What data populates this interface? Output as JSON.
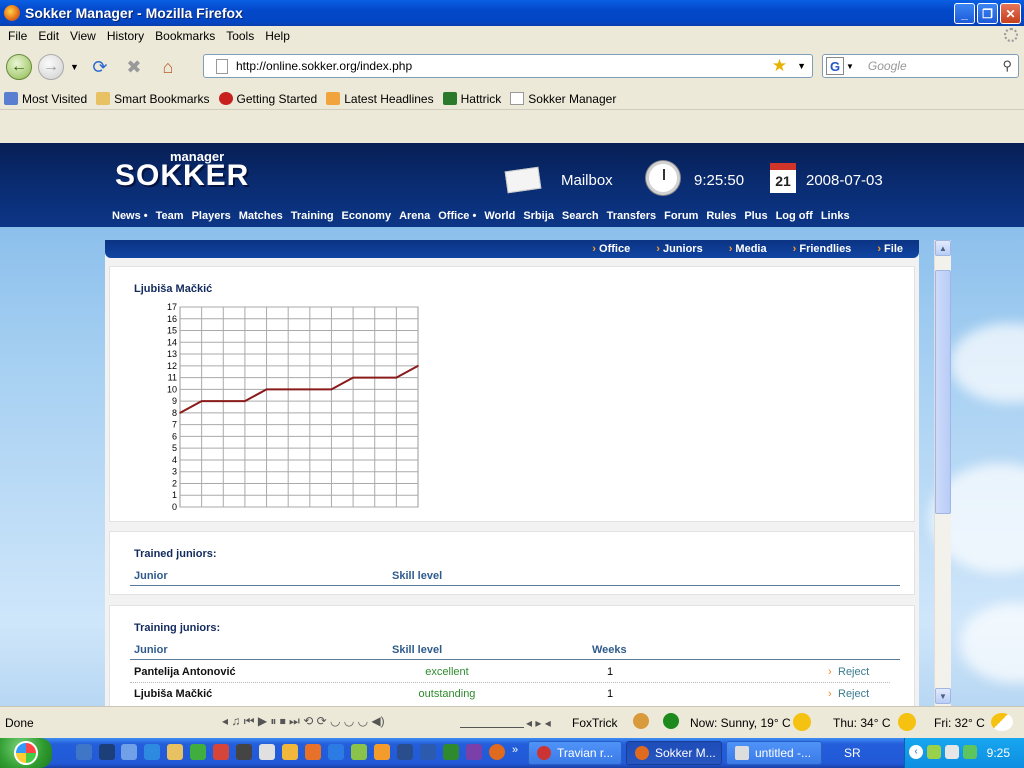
{
  "window": {
    "title": "Sokker Manager - Mozilla Firefox"
  },
  "menu": [
    "File",
    "Edit",
    "View",
    "History",
    "Bookmarks",
    "Tools",
    "Help"
  ],
  "address": {
    "url": "http://online.sokker.org/index.php",
    "search_placeholder": "Google"
  },
  "bookmarks": [
    "Most Visited",
    "Smart Bookmarks",
    "Getting Started",
    "Latest Headlines",
    "Hattrick",
    "Sokker Manager"
  ],
  "site": {
    "logo_small": "manager",
    "logo_big": "SOKKER",
    "mailbox": "Mailbox",
    "time": "9:25:50",
    "date": "2008-07-03",
    "calendar_day": "21",
    "nav": [
      "News •",
      "Team",
      "Players",
      "Matches",
      "Training",
      "Economy",
      "Arena",
      "Office •",
      "World",
      "Srbija",
      "Search",
      "Transfers",
      "Forum",
      "Rules",
      "Plus",
      "Log off",
      "Links"
    ],
    "subnav": [
      "Office",
      "Juniors",
      "Media",
      "Friendlies",
      "File"
    ]
  },
  "chart_panel": {
    "player_name": "Ljubiša Mačkić"
  },
  "chart_data": {
    "type": "line",
    "ylim": [
      0,
      17
    ],
    "y_ticks": [
      0,
      1,
      2,
      3,
      4,
      5,
      6,
      7,
      8,
      9,
      10,
      11,
      12,
      13,
      14,
      15,
      16,
      17
    ],
    "x": [
      0,
      1,
      2,
      3,
      4,
      5,
      6,
      7,
      8,
      9,
      10,
      11
    ],
    "series": [
      {
        "values": [
          8,
          9,
          9,
          9,
          10,
          10,
          10,
          10,
          11,
          11,
          11,
          12
        ],
        "color": "#8b1a1a"
      }
    ],
    "grid": true
  },
  "trained": {
    "title": "Trained juniors:",
    "col_junior": "Junior",
    "col_skill": "Skill level"
  },
  "training": {
    "title": "Training juniors:",
    "col_junior": "Junior",
    "col_skill": "Skill level",
    "col_weeks": "Weeks",
    "rows": [
      {
        "name": "Pantelija Antonović",
        "skill": "excellent",
        "weeks": "1",
        "action": "Reject"
      },
      {
        "name": "Ljubiša Mačkić",
        "skill": "outstanding",
        "weeks": "1",
        "action": "Reject"
      }
    ]
  },
  "status": {
    "done": "Done",
    "foxtrick": "FoxTrick",
    "weather_now": "Now: Sunny, 19° C",
    "weather_thu": "Thu: 34° C",
    "weather_fri": "Fri: 32° C"
  },
  "taskbar": {
    "tasks": [
      "Travian r...",
      "Sokker M...",
      "untitled -..."
    ],
    "lang": "SR",
    "clock": "9:25"
  },
  "colors": {
    "header_blue": "#0a2d74",
    "link_green": "#2f8a2f",
    "title_blue": "#0348c9"
  }
}
